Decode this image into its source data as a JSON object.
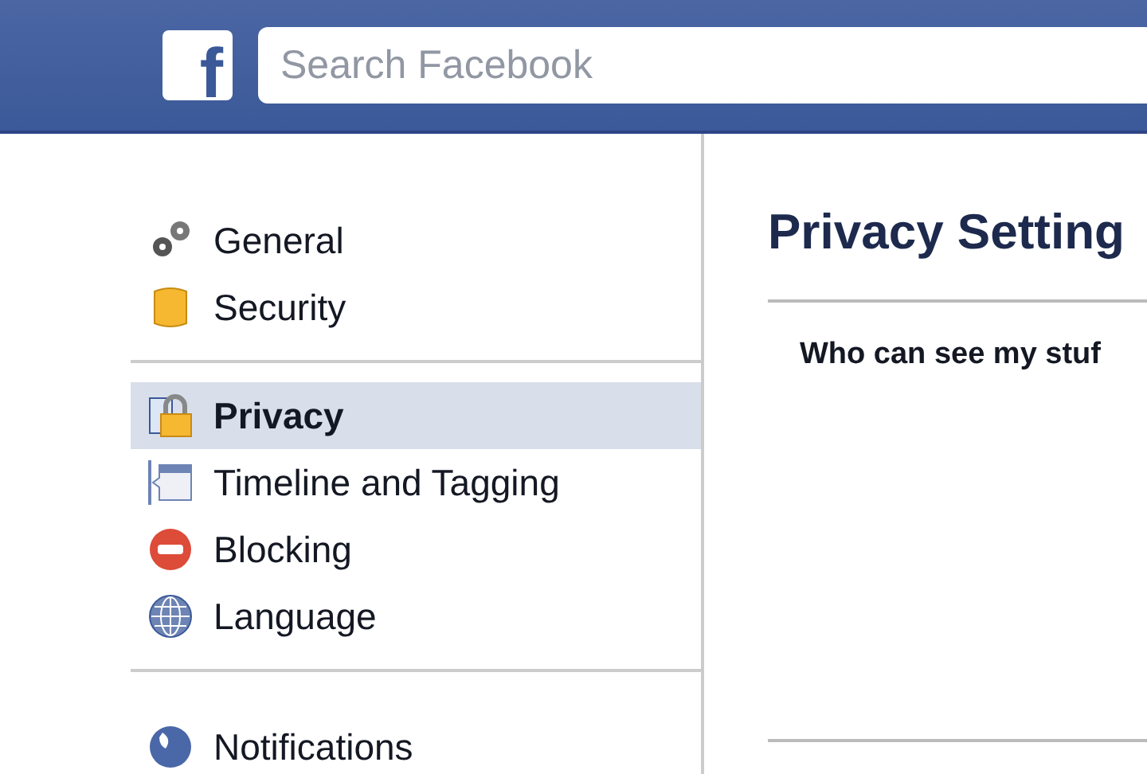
{
  "header": {
    "logo": "f",
    "search": {
      "placeholder": "Search Facebook"
    }
  },
  "sidebar": {
    "groups": [
      {
        "items": [
          {
            "label": "General",
            "selected": false
          },
          {
            "label": "Security",
            "selected": false
          }
        ]
      },
      {
        "items": [
          {
            "label": "Privacy",
            "selected": true
          },
          {
            "label": "Timeline and Tagging",
            "selected": false
          },
          {
            "label": "Blocking",
            "selected": false
          },
          {
            "label": "Language",
            "selected": false
          }
        ]
      },
      {
        "items": [
          {
            "label": "Notifications",
            "selected": false
          }
        ]
      }
    ]
  },
  "main": {
    "title": "Privacy Setting",
    "sections": [
      {
        "heading": "Who can see my stuf"
      }
    ]
  }
}
